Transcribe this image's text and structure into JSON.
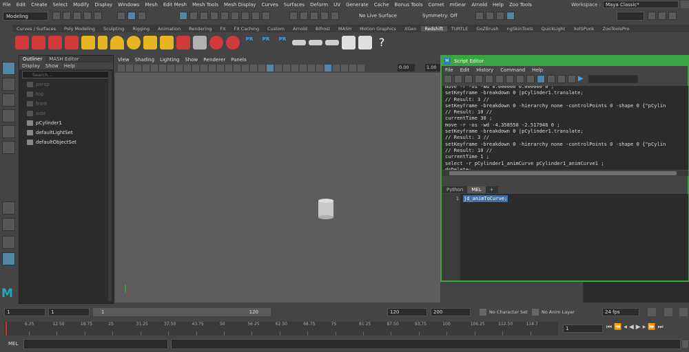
{
  "menubar": [
    "File",
    "Edit",
    "Create",
    "Select",
    "Modify",
    "Display",
    "Windows",
    "Mesh",
    "Edit Mesh",
    "Mesh Tools",
    "Mesh Display",
    "Curves",
    "Surfaces",
    "Deform",
    "UV",
    "Generate",
    "Cache",
    "Bonus Tools",
    "Comet",
    "mGear",
    "Arnold",
    "Help",
    "Zoo Tools"
  ],
  "workspace": {
    "label": "Workspace :",
    "value": "Maya Classic*"
  },
  "status": {
    "mode": "Modeling",
    "live_surface": "No Live Surface",
    "symmetry": "Symmetry: Off"
  },
  "shelf_tabs": [
    "Curves / Surfaces",
    "Poly Modeling",
    "Sculpting",
    "Rigging",
    "Animation",
    "Rendering",
    "FX",
    "FX Caching",
    "Custom",
    "Arnold",
    "Bifrost",
    "MASH",
    "Motion Graphics",
    "XGen",
    "Redshift",
    "TURTLE",
    "GoZBrush",
    "ngSkinTools",
    "QuickLight",
    "XolSPunk",
    "ZooToolsPro"
  ],
  "shelf_active": "Redshift",
  "shelf_labels": {
    "pr1": "PR",
    "pr2": "PR",
    "pr3": "PR"
  },
  "outliner": {
    "tabs": [
      "Outliner",
      "MASH Editor"
    ],
    "menu": [
      "Display",
      "Show",
      "Help"
    ],
    "search_placeholder": "Search...",
    "items": [
      {
        "label": "persp",
        "dim": true
      },
      {
        "label": "top",
        "dim": true
      },
      {
        "label": "front",
        "dim": true
      },
      {
        "label": "side",
        "dim": true
      },
      {
        "label": "pCylinder1",
        "dim": false
      },
      {
        "label": "defaultLightSet",
        "dim": false
      },
      {
        "label": "defaultObjectSet",
        "dim": false
      }
    ]
  },
  "viewport": {
    "menu": [
      "View",
      "Shading",
      "Lighting",
      "Show",
      "Renderer",
      "Panels"
    ],
    "val_a": "0.00",
    "val_b": "1.00"
  },
  "script_editor": {
    "title": "Script Editor",
    "menu": [
      "File",
      "Edit",
      "History",
      "Command",
      "Help"
    ],
    "history": "move -r -os -wd 0.000000 0.000000 0 ;\nsetKeyframe -breakdown 0 |pCylinder1.translate;\n// Result: 3 //\nsetKeyframe -breakdown 0 -hierarchy none -controlPoints 0 -shape 0 {\"pCylin\n// Result: 10 //\ncurrentTime 30 ;\nmove -r -os -wd -4.358558 -2.517946 0 ;\nsetKeyframe -breakdown 0 |pCylinder1.translate;\n// Result: 3 //\nsetKeyframe -breakdown 0 -hierarchy none -controlPoints 0 -shape 0 {\"pCylin\n// Result: 10 //\ncurrentTime 1 ;\nselect -r pCylinder1_animCurve pCylinder1_animCurve1 ;\ndoDelete;",
    "tabs": [
      "Python",
      "MEL",
      "+"
    ],
    "line_number": "1",
    "input": "jd_animToCurve;"
  },
  "timeline": {
    "start": "1",
    "range_start": "1",
    "range_inner_start": "1",
    "range_inner_end": "120",
    "range_end": "120",
    "end": "200",
    "character_set": "No Character Set",
    "anim_layer": "No Anim Layer",
    "fps": "24 fps",
    "current_frame": "1",
    "ticks": [
      "6.25",
      "12.50",
      "18.75",
      "25",
      "31.25",
      "37.50",
      "43.75",
      "50",
      "56.25",
      "62.50",
      "68.75",
      "75",
      "81.25",
      "87.50",
      "93.75",
      "100",
      "106.25",
      "112.50",
      "118.7"
    ]
  },
  "command_line": {
    "label": "MEL"
  }
}
